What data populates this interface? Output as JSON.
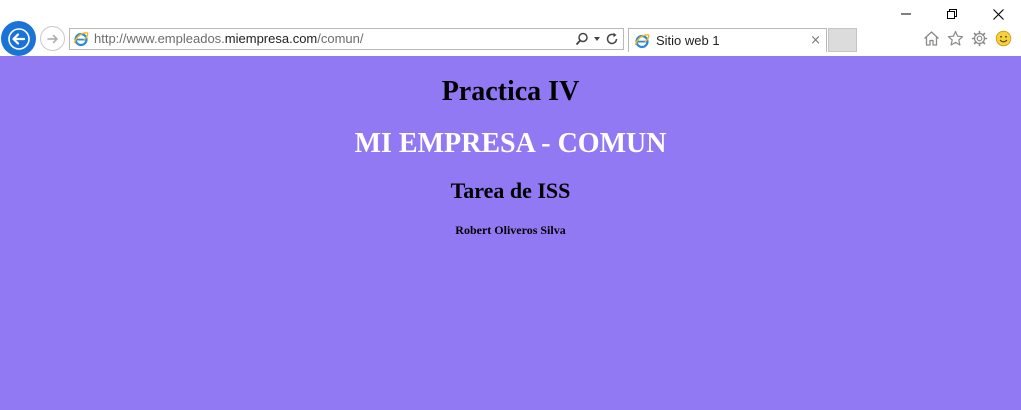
{
  "browser": {
    "address_prefix": "http://www.empleados.",
    "address_domain": "miempresa.com",
    "address_suffix": "/comun/",
    "tab_title": "Sitio web 1",
    "tab_close": "×"
  },
  "page": {
    "heading1": "Practica IV",
    "heading2": "MI EMPRESA - COMUN",
    "heading3": "Tarea de ISS",
    "author": "Robert Oliveros Silva",
    "background": "#9079f3"
  },
  "icons": {
    "minimize": "minimize-icon",
    "restore": "restore-icon",
    "close": "close-icon",
    "back": "back-arrow-icon",
    "forward": "forward-arrow-icon",
    "ie": "ie-logo-icon",
    "search": "search-icon",
    "dropdown": "chevron-down-icon",
    "refresh": "refresh-icon",
    "home": "home-icon",
    "favorites": "star-icon",
    "settings": "gear-icon",
    "feedback": "smiley-icon"
  }
}
